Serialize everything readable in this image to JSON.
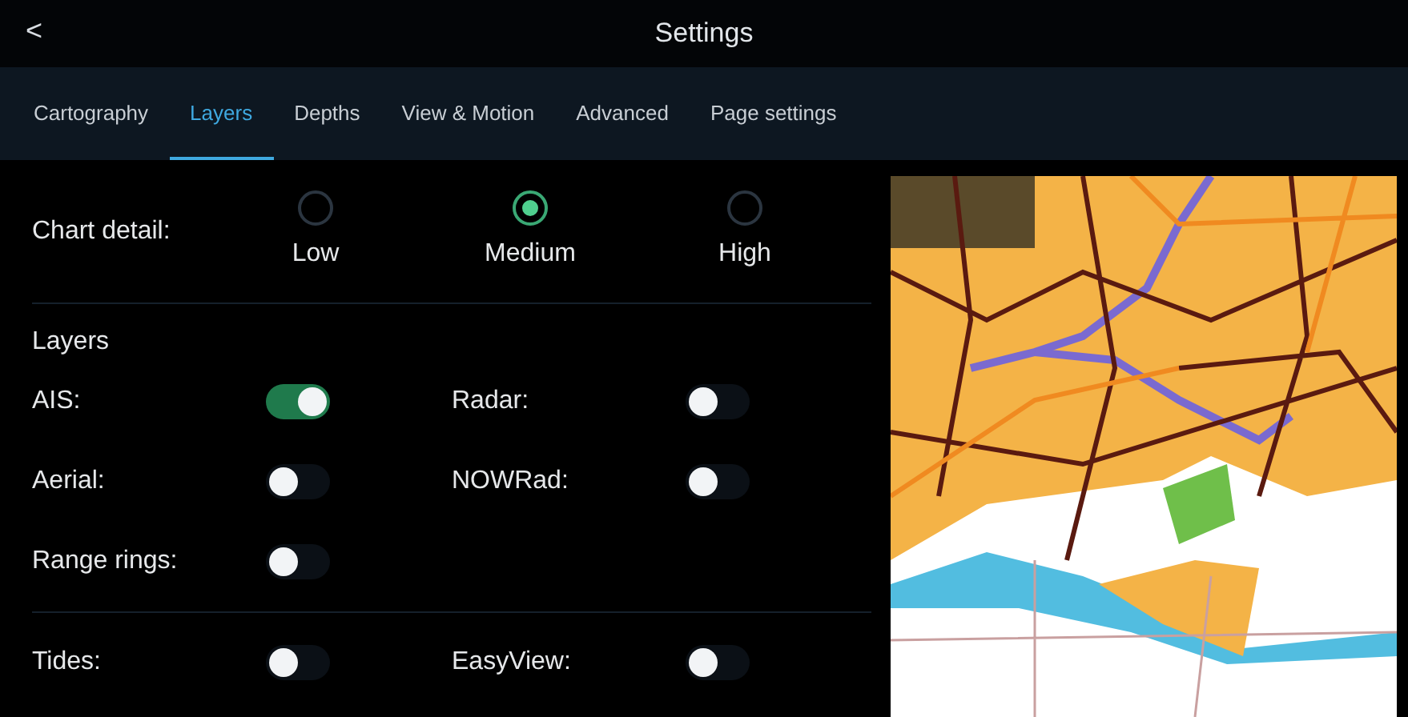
{
  "window": {
    "title": "Settings",
    "back": "<"
  },
  "tabs": [
    {
      "label": "Cartography",
      "selected": false
    },
    {
      "label": "Layers",
      "selected": true
    },
    {
      "label": "Depths",
      "selected": false
    },
    {
      "label": "View & Motion",
      "selected": false
    },
    {
      "label": "Advanced",
      "selected": false
    },
    {
      "label": "Page settings",
      "selected": false
    }
  ],
  "chart_detail": {
    "label": "Chart detail:",
    "options": [
      {
        "label": "Low",
        "selected": false
      },
      {
        "label": "Medium",
        "selected": true
      },
      {
        "label": "High",
        "selected": false
      }
    ]
  },
  "layers": {
    "heading": "Layers",
    "groups": [
      {
        "rows": [
          [
            {
              "label": "AIS:",
              "on": true
            },
            {
              "label": "Radar:",
              "on": false
            }
          ],
          [
            {
              "label": "Aerial:",
              "on": false
            },
            {
              "label": "NOWRad:",
              "on": false
            }
          ],
          [
            {
              "label": "Range rings:",
              "on": false
            }
          ]
        ]
      },
      {
        "rows": [
          [
            {
              "label": "Tides:",
              "on": false
            },
            {
              "label": "EasyView:",
              "on": false
            }
          ]
        ]
      }
    ]
  }
}
